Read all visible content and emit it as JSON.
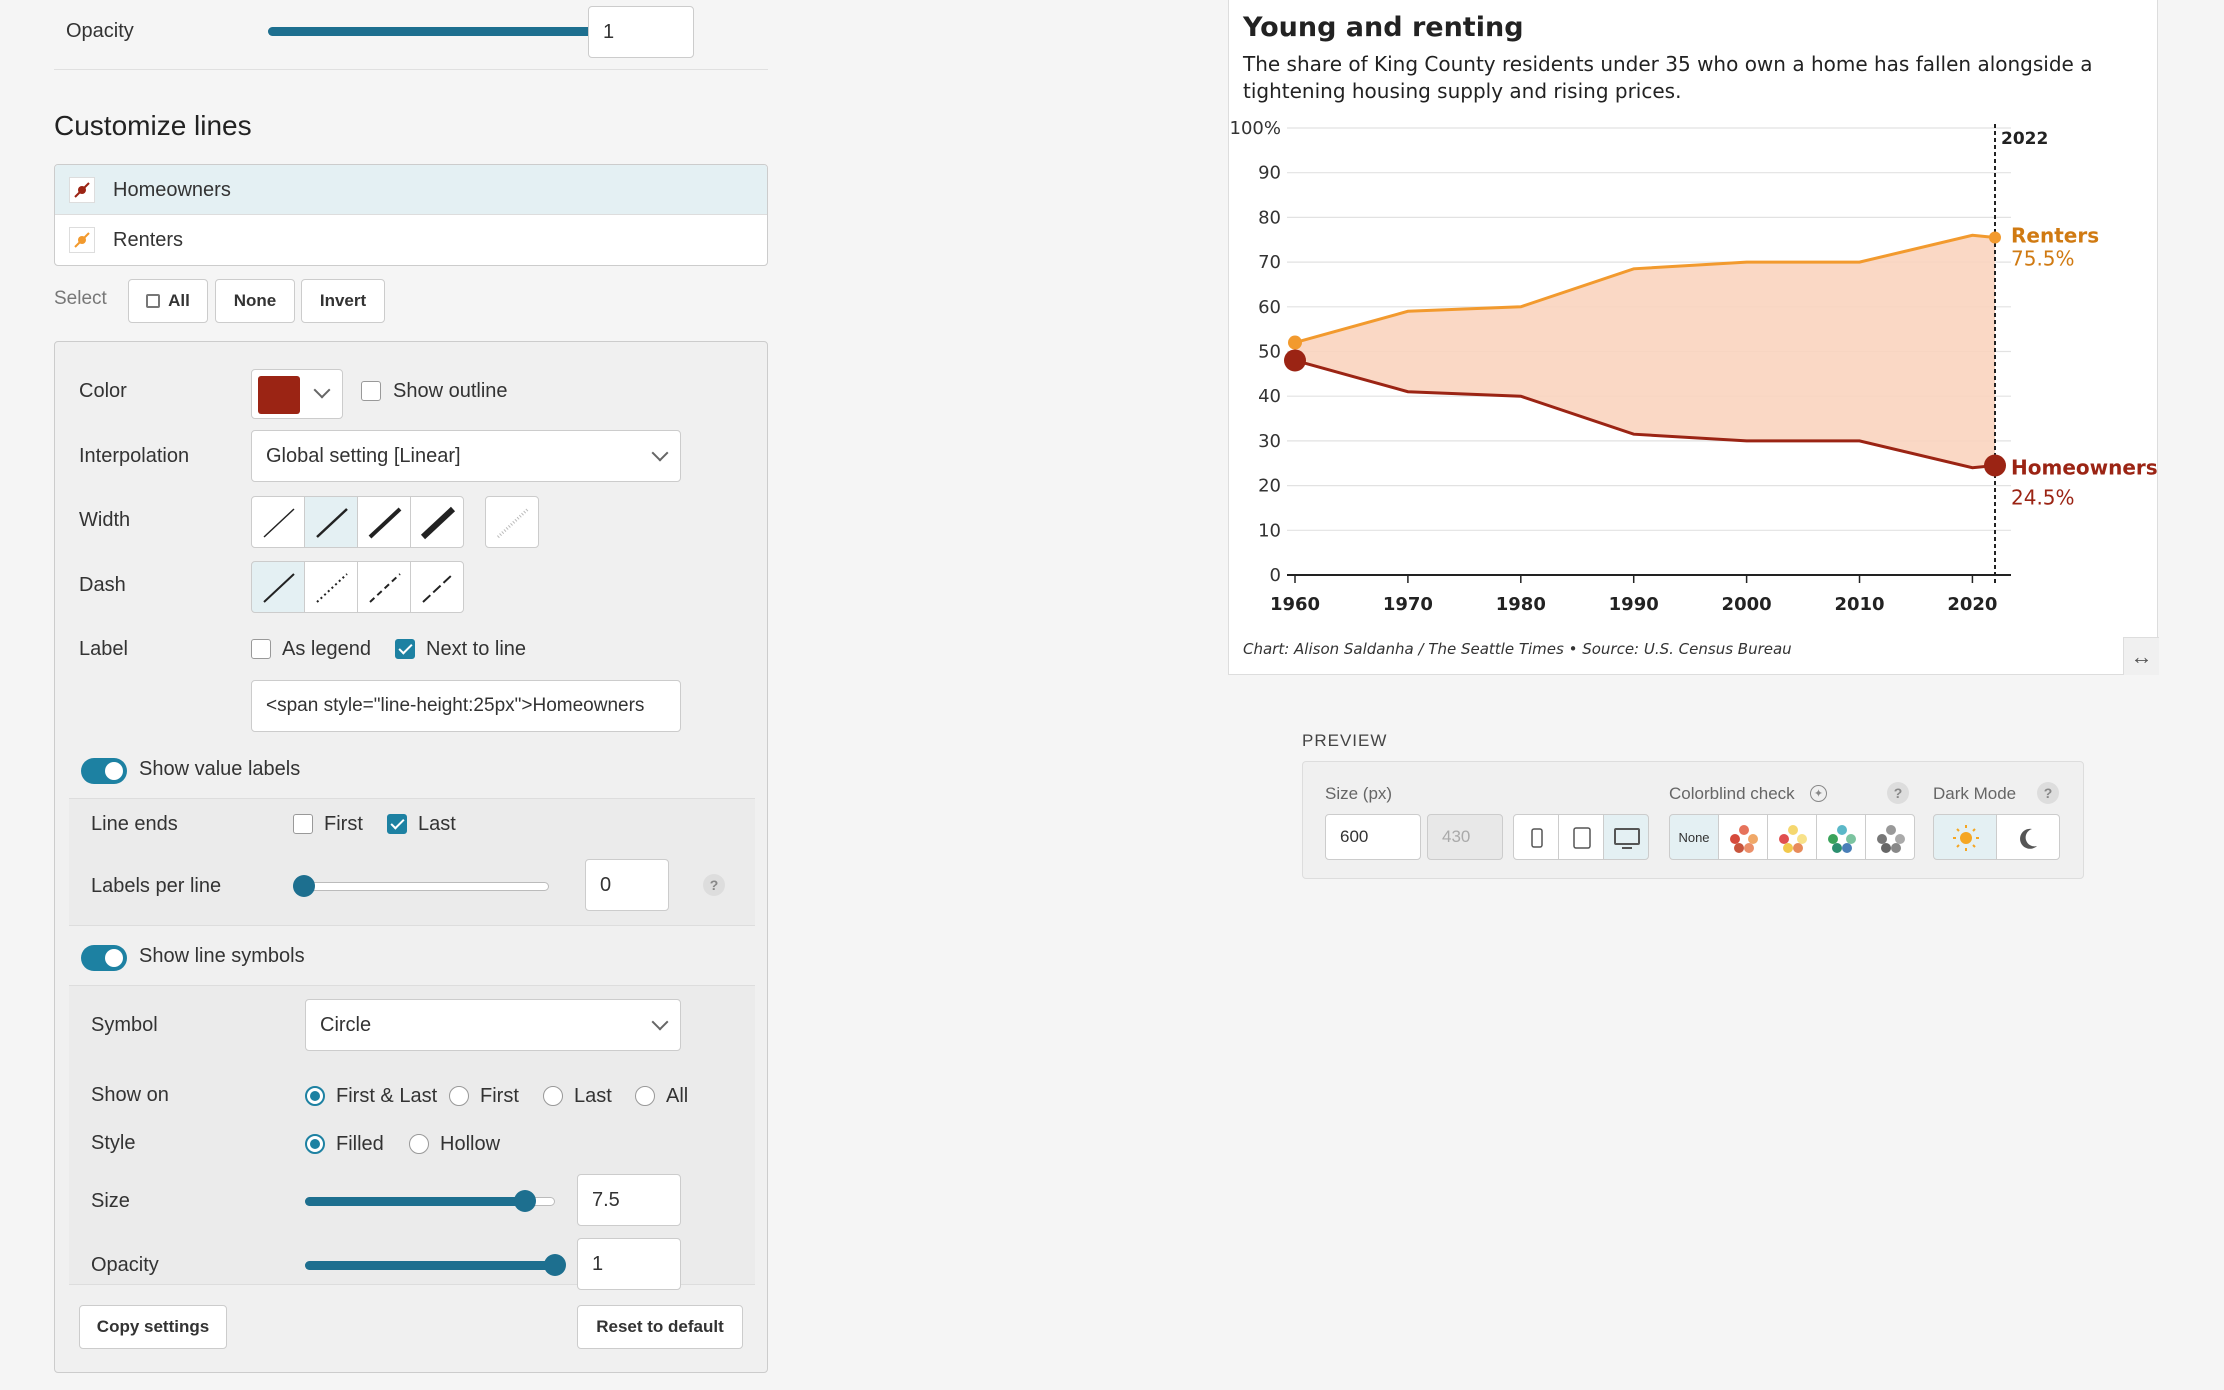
{
  "top_opacity": {
    "label": "Opacity",
    "value": "1",
    "level": 1.0
  },
  "customize": {
    "title": "Customize lines",
    "lines": [
      {
        "label": "Homeowners",
        "color": "#9b2414",
        "selected": true
      },
      {
        "label": "Renters",
        "color": "#f29a2e",
        "selected": false
      }
    ],
    "select_label": "Select",
    "select_buttons": [
      "All",
      "None",
      "Invert"
    ]
  },
  "settings": {
    "color_label": "Color",
    "color_value": "#9b2414",
    "show_outline_label": "Show outline",
    "interpolation_label": "Interpolation",
    "interpolation_value": "Global setting [Linear]",
    "width_label": "Width",
    "dash_label": "Dash",
    "label_label": "Label",
    "as_legend_label": "As legend",
    "next_to_line_label": "Next to line",
    "label_text_value": "<span style=\"line-height:25px\">Homeowners",
    "show_value_labels": "Show value labels",
    "line_ends_label": "Line ends",
    "first_label": "First",
    "last_label": "Last",
    "labels_per_line_label": "Labels per line",
    "labels_per_line_value": "0",
    "show_line_symbols": "Show line symbols",
    "symbol_label": "Symbol",
    "symbol_value": "Circle",
    "show_on_label": "Show on",
    "show_on_options": [
      "First & Last",
      "First",
      "Last",
      "All"
    ],
    "style_label": "Style",
    "style_options": [
      "Filled",
      "Hollow"
    ],
    "size_label": "Size",
    "size_value": "7.5",
    "size_level": 0.88,
    "opacity_label": "Opacity",
    "opacity_value": "1",
    "opacity_level": 1.0,
    "copy_settings": "Copy settings",
    "reset_default": "Reset to default"
  },
  "chart": {
    "title": "Young and renting",
    "subtitle_line1": "The share of King County residents under 35 who own a home has fallen alongside a",
    "subtitle_line2": "tightening housing supply and rising prices.",
    "credit": "Chart: Alison Saldanha / The Seattle Times • Source: U.S. Census Bureau",
    "resize_icon": "↔"
  },
  "chart_data": {
    "type": "line",
    "title": "Young and renting",
    "x": [
      1960,
      1970,
      1980,
      1990,
      2000,
      2010,
      2020,
      2022
    ],
    "x_ticks": [
      1960,
      1970,
      1980,
      1990,
      2000,
      2010,
      2020
    ],
    "y_ticks": [
      "0",
      "10",
      "20",
      "30",
      "40",
      "50",
      "60",
      "70",
      "80",
      "90",
      "100%"
    ],
    "ylim": [
      0,
      100
    ],
    "xlim": [
      1960,
      2022
    ],
    "grid": true,
    "series": [
      {
        "name": "Renters",
        "color": "#f29a2e",
        "values": [
          52,
          59,
          60,
          68.5,
          70,
          70,
          76,
          75.5
        ],
        "label_value": "75.5%"
      },
      {
        "name": "Homeowners",
        "color": "#9b2414",
        "values": [
          48,
          41,
          40,
          31.5,
          30,
          30,
          24,
          24.5
        ],
        "label_value": "24.5%"
      }
    ],
    "fill_between": "#f9d4bf",
    "annotation": {
      "x": 2022,
      "label": "2022"
    }
  },
  "preview": {
    "title": "PREVIEW",
    "size_label": "Size (px)",
    "width_value": "600",
    "height_value": "430",
    "colorblind_label": "Colorblind check",
    "colorblind_none": "None",
    "dark_mode_label": "Dark Mode"
  }
}
